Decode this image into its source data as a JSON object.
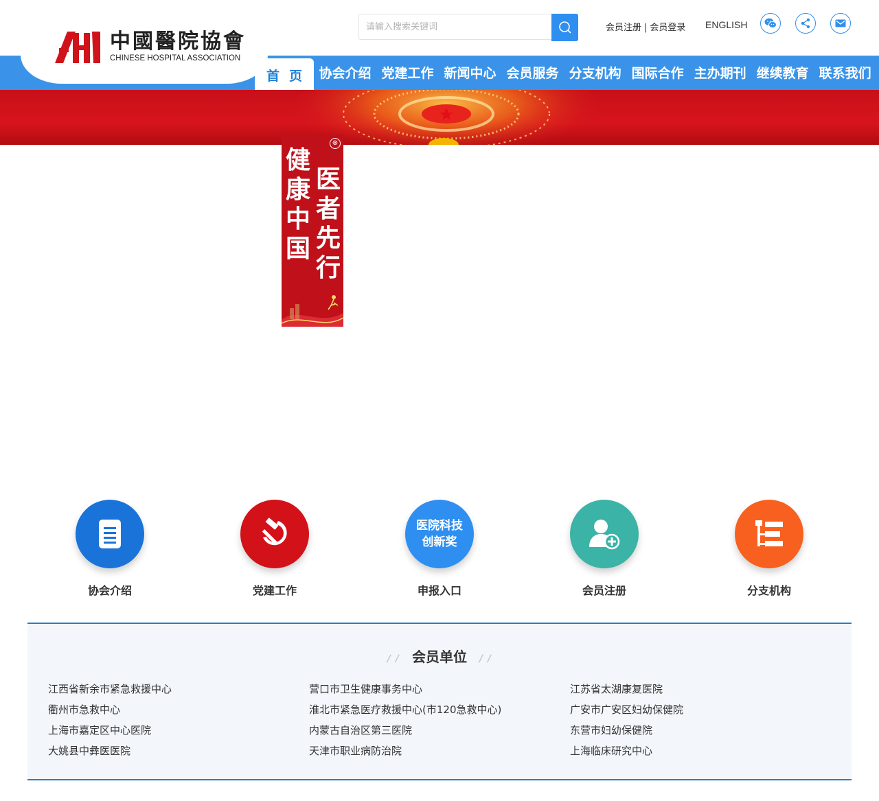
{
  "logo": {
    "cn": "中國醫院協會",
    "en": "CHINESE HOSPITAL ASSOCIATION"
  },
  "search": {
    "placeholder": "请输入搜索关键词",
    "icon": "search-icon"
  },
  "toplinks": {
    "register": "会员注册",
    "separator": "|",
    "login": "会员登录",
    "english": "ENGLISH"
  },
  "social": [
    {
      "icon": "wechat-icon"
    },
    {
      "icon": "share-icon"
    },
    {
      "icon": "mail-icon"
    }
  ],
  "nav": [
    "首页",
    "协会介绍",
    "党建工作",
    "新闻中心",
    "会员服务",
    "分支机构",
    "国际合作",
    "主办期刊",
    "继续教育",
    "联系我们"
  ],
  "float_ad": {
    "close": "⊗",
    "col1": "健康中国",
    "col2": "医者先行"
  },
  "quick_links": [
    {
      "label": "协会介绍",
      "icon": "document-icon",
      "color": "#1a73d9"
    },
    {
      "label": "党建工作",
      "icon": "hammer-sickle-icon",
      "color": "#d21119"
    },
    {
      "label": "申报入口",
      "inner_line1": "医院科技",
      "inner_line2": "创新奖",
      "color": "#2f8ff0"
    },
    {
      "label": "会员注册",
      "icon": "add-user-icon",
      "color": "#3bb3a7"
    },
    {
      "label": "分支机构",
      "icon": "branch-structure-icon",
      "color": "#f8601f"
    }
  ],
  "members": {
    "title": "会员单位",
    "columns": [
      [
        "江西省新余市紧急救援中心",
        "衢州市急救中心",
        "上海市嘉定区中心医院",
        "大姚县中彝医医院"
      ],
      [
        "营口市卫生健康事务中心",
        "淮北市紧急医疗救援中心(市120急救中心)",
        "内蒙古自治区第三医院",
        "天津市职业病防治院"
      ],
      [
        "江苏省太湖康复医院",
        "广安市广安区妇幼保健院",
        "东营市妇幼保健院",
        "上海临床研究中心"
      ]
    ]
  },
  "colors": {
    "brand_blue": "#3a93e8",
    "brand_red": "#c8101a"
  }
}
